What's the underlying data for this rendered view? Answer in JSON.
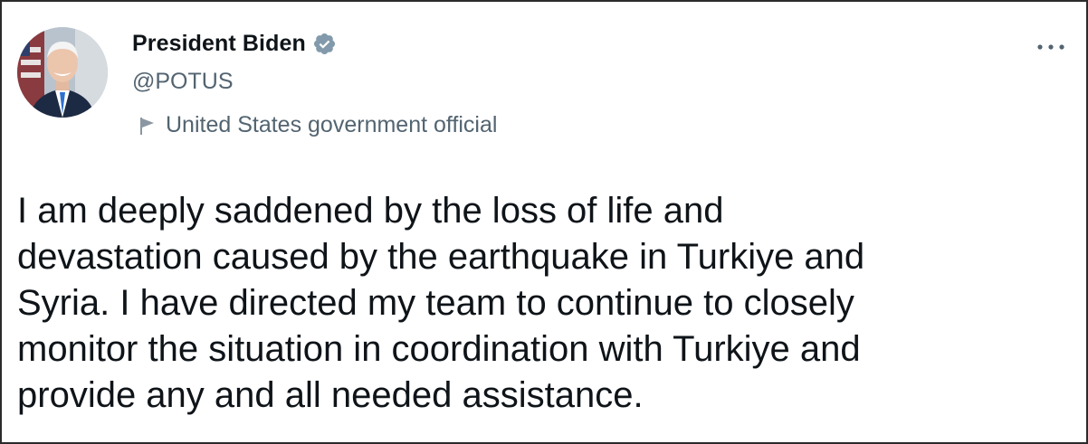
{
  "author": {
    "display_name": "President Biden",
    "handle": "@POTUS",
    "verified": true,
    "avatar_icon": "portrait-avatar",
    "label_icon": "flag-icon",
    "label": "United States government official"
  },
  "menu": {
    "icon": "more-horizontal-icon"
  },
  "tweet": {
    "lines": [
      "I am deeply saddened by the loss of life and",
      "devastation caused by the earthquake in Turkiye and",
      "Syria. I have directed my team to continue to closely",
      "monitor the situation in coordination with Turkiye and",
      "provide any and all needed assistance."
    ]
  },
  "colors": {
    "primary_text": "#0f1419",
    "secondary_text": "#536471",
    "verified_badge": "#829aab",
    "border": "#2b2b2b"
  }
}
